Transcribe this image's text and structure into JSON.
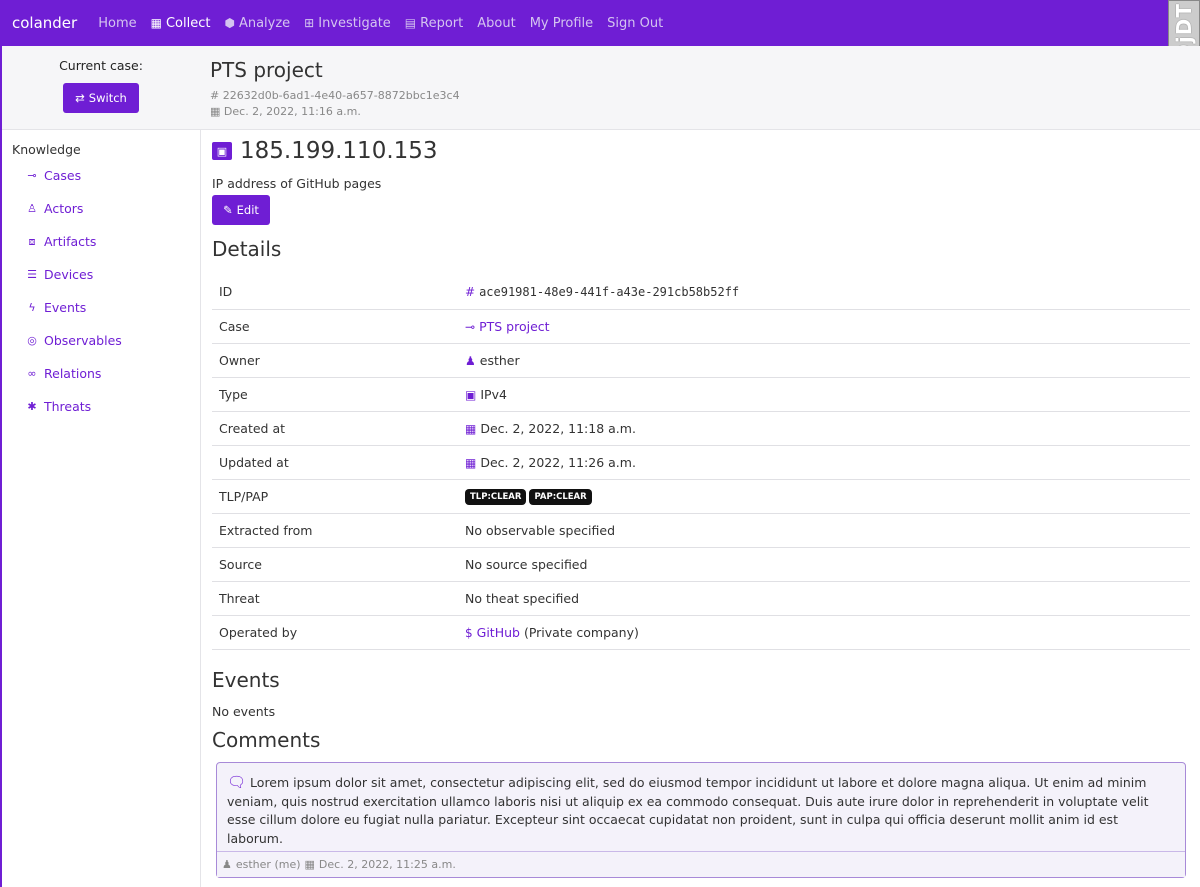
{
  "brand": "colander",
  "nav": {
    "home": "Home",
    "collect": "Collect",
    "analyze": "Analyze",
    "investigate": "Investigate",
    "report": "Report",
    "about": "About",
    "profile": "My Profile",
    "signout": "Sign Out"
  },
  "debug_toolbar": "DjDT",
  "case": {
    "label": "Current case:",
    "switch_label": "Switch",
    "title": "PTS project",
    "id": "22632d0b-6ad1-4e40-a657-8872bbc1e3c4",
    "date": "Dec. 2, 2022, 11:16 a.m."
  },
  "sidebar": {
    "heading": "Knowledge",
    "items": [
      {
        "label": "Cases",
        "icon": "cases-icon"
      },
      {
        "label": "Actors",
        "icon": "actor-icon"
      },
      {
        "label": "Artifacts",
        "icon": "artifact-icon"
      },
      {
        "label": "Devices",
        "icon": "device-icon"
      },
      {
        "label": "Events",
        "icon": "event-icon"
      },
      {
        "label": "Observables",
        "icon": "observable-icon"
      },
      {
        "label": "Relations",
        "icon": "relation-icon"
      },
      {
        "label": "Threats",
        "icon": "threat-icon"
      }
    ]
  },
  "observable": {
    "title": "185.199.110.153",
    "description": "IP address of GitHub pages",
    "edit_label": "Edit"
  },
  "details": {
    "heading": "Details",
    "rows": {
      "id": {
        "label": "ID",
        "value": "ace91981-48e9-441f-a43e-291cb58b52ff"
      },
      "case": {
        "label": "Case",
        "value": "PTS project"
      },
      "owner": {
        "label": "Owner",
        "value": "esther"
      },
      "type": {
        "label": "Type",
        "value": "IPv4"
      },
      "created": {
        "label": "Created at",
        "value": "Dec. 2, 2022, 11:18 a.m."
      },
      "updated": {
        "label": "Updated at",
        "value": "Dec. 2, 2022, 11:26 a.m."
      },
      "tlp": {
        "label": "TLP/PAP",
        "tlp": "TLP:CLEAR",
        "pap": "PAP:CLEAR"
      },
      "extracted": {
        "label": "Extracted from",
        "value": "No observable specified"
      },
      "source": {
        "label": "Source",
        "value": "No source specified"
      },
      "threat": {
        "label": "Threat",
        "value": "No theat specified"
      },
      "operated": {
        "label": "Operated by",
        "link": "GitHub",
        "suffix": "(Private company)"
      }
    }
  },
  "events": {
    "heading": "Events",
    "empty": "No events"
  },
  "comments": {
    "heading": "Comments",
    "items": [
      {
        "text": "Lorem ipsum dolor sit amet, consectetur adipiscing elit, sed do eiusmod tempor incididunt ut labore et dolore magna aliqua. Ut enim ad minim veniam, quis nostrud exercitation ullamco laboris nisi ut aliquip ex ea commodo consequat. Duis aute irure dolor in reprehenderit in voluptate velit esse cillum dolore eu fugiat nulla pariatur. Excepteur sint occaecat cupidatat non proident, sunt in culpa qui officia deserunt mollit anim id est laborum.",
        "author": "esther (me)",
        "date": "Dec. 2, 2022, 11:25 a.m."
      }
    ]
  },
  "colors": {
    "accent": "#6f1ed4",
    "badge_bg": "#111111"
  }
}
